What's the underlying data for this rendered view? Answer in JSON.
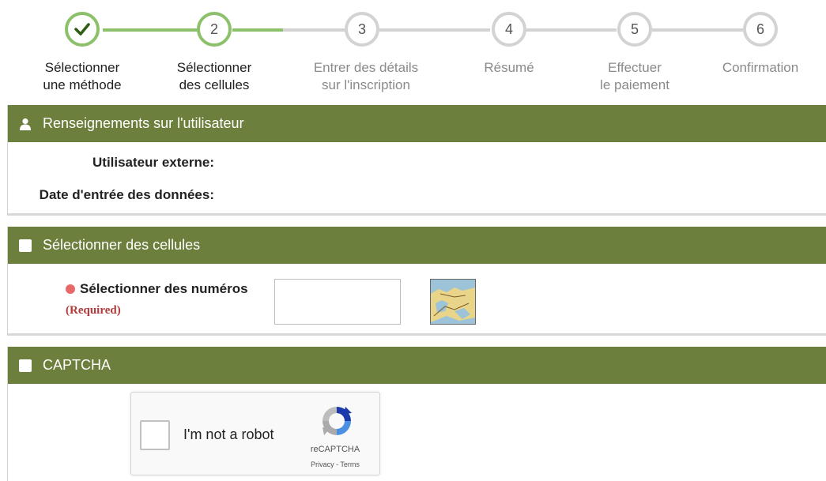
{
  "stepper": {
    "steps": [
      {
        "number": "",
        "label": "Sélectionner\nune méthode",
        "state": "done",
        "icon": "checkmark-icon"
      },
      {
        "number": "2",
        "label": "Sélectionner\ndes cellules",
        "state": "active"
      },
      {
        "number": "3",
        "label": "Entrer des détails\nsur l'inscription",
        "state": "todo"
      },
      {
        "number": "4",
        "label": "Résumé",
        "state": "todo"
      },
      {
        "number": "5",
        "label": "Effectuer\nle paiement",
        "state": "todo"
      },
      {
        "number": "6",
        "label": "Confirmation",
        "state": "todo"
      }
    ]
  },
  "user_panel": {
    "title": "Renseignements sur l'utilisateur",
    "icon": "user-icon",
    "external_user_label": "Utilisateur externe:",
    "date_label": "Date d'entrée des données:"
  },
  "cells_panel": {
    "title": "Sélectionner des cellules",
    "numbers_label": "Sélectionner des numéros",
    "required_text": "(Required)",
    "numbers_value": "",
    "map_icon": "map-icon"
  },
  "captcha_panel": {
    "title": "CAPTCHA",
    "checkbox_text": "I'm not a robot",
    "brand": "reCAPTCHA",
    "links": "Privacy - Terms"
  },
  "colors": {
    "header_green": "#6d7f3c",
    "step_done": "#8cc06a",
    "step_todo": "#d3d3d3",
    "required_red": "#e8686a",
    "required_text": "#b23a3a"
  }
}
